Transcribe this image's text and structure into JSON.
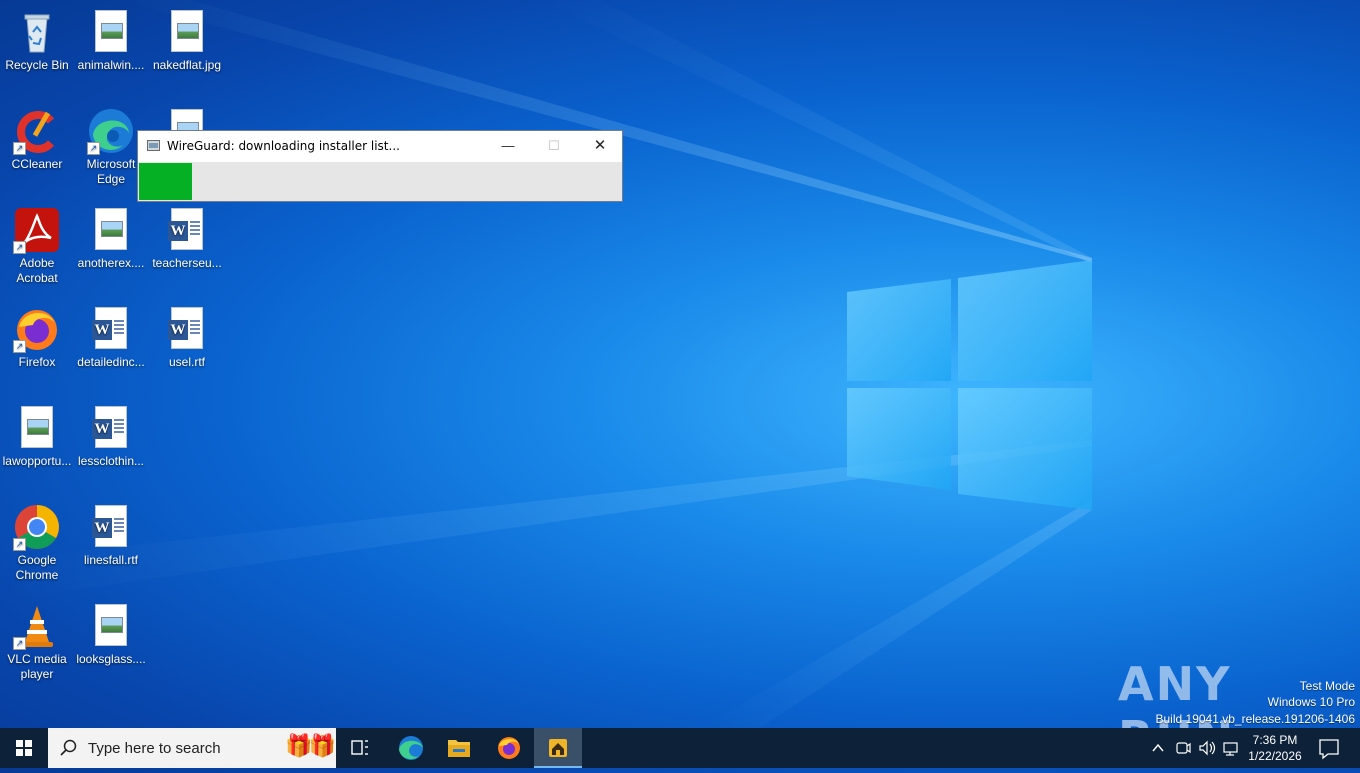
{
  "desktop": {
    "icons": [
      {
        "label": "Recycle Bin",
        "icon": "recycle-bin-icon"
      },
      {
        "label": "animalwin....",
        "icon": "image-file-icon"
      },
      {
        "label": "nakedflat.jpg",
        "icon": "image-file-icon"
      },
      {
        "label": "CCleaner",
        "icon": "ccleaner-icon"
      },
      {
        "label": "Microsoft Edge",
        "icon": "edge-icon"
      },
      {
        "label": "Adobe Acrobat",
        "icon": "acrobat-icon"
      },
      {
        "label": "anotherex....",
        "icon": "image-file-icon"
      },
      {
        "label": "teacherseu...",
        "icon": "word-doc-icon"
      },
      {
        "label": "Firefox",
        "icon": "firefox-icon"
      },
      {
        "label": "detailedinc...",
        "icon": "word-doc-icon"
      },
      {
        "label": "usel.rtf",
        "icon": "word-doc-icon"
      },
      {
        "label": "lawopportu...",
        "icon": "image-file-icon"
      },
      {
        "label": "lessclothin...",
        "icon": "word-doc-icon"
      },
      {
        "label": "Google Chrome",
        "icon": "chrome-icon"
      },
      {
        "label": "linesfall.rtf",
        "icon": "word-doc-icon"
      },
      {
        "label": "VLC media player",
        "icon": "vlc-icon"
      },
      {
        "label": "looksglass....",
        "icon": "image-file-icon"
      }
    ]
  },
  "dialog": {
    "title": "WireGuard: downloading installer list...",
    "minimize": "—",
    "maximize": "☐",
    "close": "✕",
    "progress_fraction": 0.11,
    "progress_color": "#06b025"
  },
  "watermark": {
    "brand": "ANY RUN",
    "line1": "Test Mode",
    "line2": "Windows 10 Pro",
    "line3": "Build 19041.vb_release.191206-1406"
  },
  "taskbar": {
    "search_placeholder": "Type here to search",
    "time": "7:36 PM",
    "date": "1/22/2026"
  }
}
